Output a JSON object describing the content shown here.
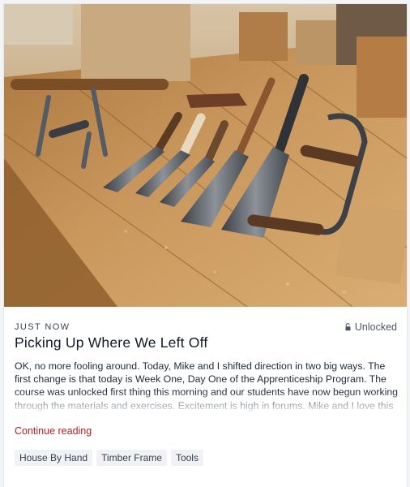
{
  "post": {
    "timestamp": "JUST NOW",
    "access_label": "Unlocked",
    "access_icon": "unlocked-icon",
    "title": "Picking Up Where We Left Off",
    "excerpt": "OK, no more fooling around. Today, Mike and I shifted direction in two big ways. The first change is that today is Week One, Day One of the Apprenticeship Program. The course was unlocked first thing this morning and our students have now begun working through the materials and exercises. Excitement is high in forums. Mike and I love this program so much",
    "continue_label": "Continue reading",
    "tags": [
      "House By Hand",
      "Timber Frame",
      "Tools"
    ]
  },
  "colors": {
    "accent": "#b91c1c",
    "tag_background": "#f1f2f5",
    "text": "#111827"
  }
}
